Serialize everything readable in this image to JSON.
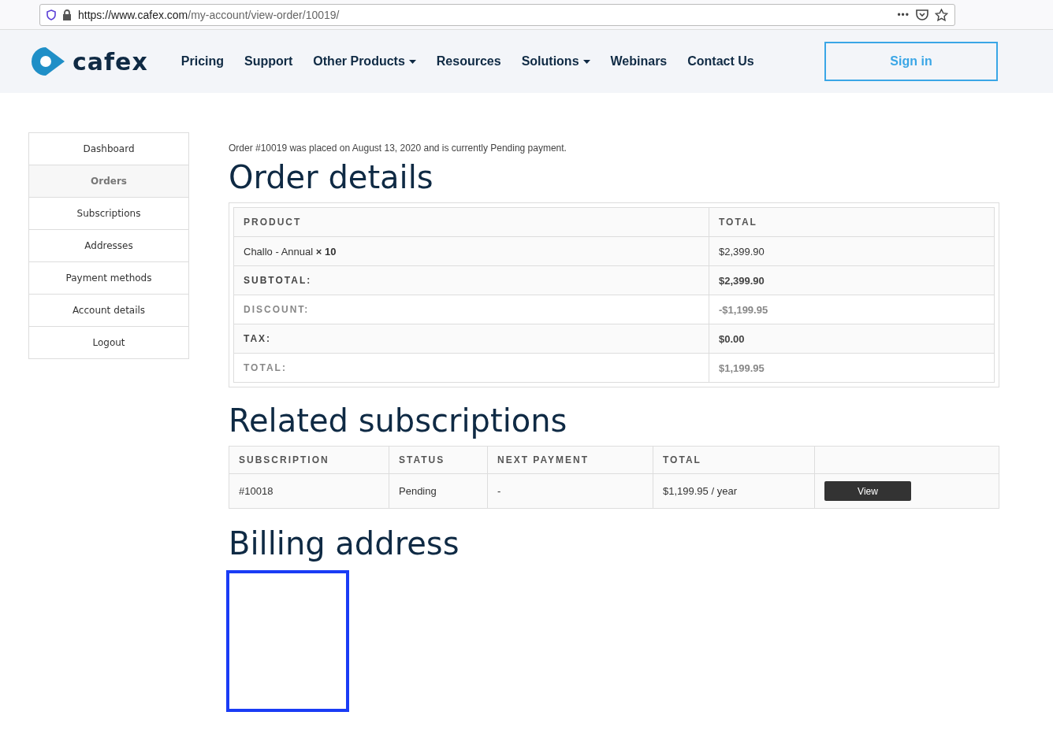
{
  "browser": {
    "url_host": "https://www.cafex.com",
    "url_path": "/my-account/view-order/10019/",
    "more": "•••"
  },
  "header": {
    "logo": "cafex",
    "nav": [
      {
        "label": "Pricing",
        "dropdown": false
      },
      {
        "label": "Support",
        "dropdown": false
      },
      {
        "label": "Other Products",
        "dropdown": true
      },
      {
        "label": "Resources",
        "dropdown": false
      },
      {
        "label": "Solutions",
        "dropdown": true
      },
      {
        "label": "Webinars",
        "dropdown": false
      },
      {
        "label": "Contact Us",
        "dropdown": false
      }
    ],
    "sign_in": "Sign in"
  },
  "sidebar": {
    "items": [
      {
        "label": "Dashboard",
        "selected": false
      },
      {
        "label": "Orders",
        "selected": true
      },
      {
        "label": "Subscriptions",
        "selected": false
      },
      {
        "label": "Addresses",
        "selected": false
      },
      {
        "label": "Payment methods",
        "selected": false
      },
      {
        "label": "Account details",
        "selected": false
      },
      {
        "label": "Logout",
        "selected": false
      }
    ]
  },
  "order_notice": "Order #10019 was placed on August 13, 2020 and is currently Pending payment.",
  "order_details": {
    "title": "Order details",
    "columns": [
      "PRODUCT",
      "TOTAL"
    ],
    "items": [
      {
        "product": "Challo - Annual **× 10**",
        "total": "$2,399.90"
      }
    ],
    "totals": [
      {
        "label": "SUBTOTAL:",
        "value": "$2,399.90"
      },
      {
        "label": "DISCOUNT:",
        "value": "-$1,199.95"
      },
      {
        "label": "TAX:",
        "value": "$0.00"
      },
      {
        "label": "TOTAL:",
        "value": "$1,199.95"
      }
    ]
  },
  "related_subscriptions": {
    "title": "Related subscriptions",
    "columns": [
      "SUBSCRIPTION",
      "STATUS",
      "NEXT PAYMENT",
      "TOTAL"
    ],
    "rows": [
      {
        "subscription": "#10018",
        "status": "Pending",
        "next_payment": "-",
        "total": "$1,199.95 / year",
        "action": "View"
      }
    ]
  },
  "billing_address": {
    "title": "Billing address"
  }
}
